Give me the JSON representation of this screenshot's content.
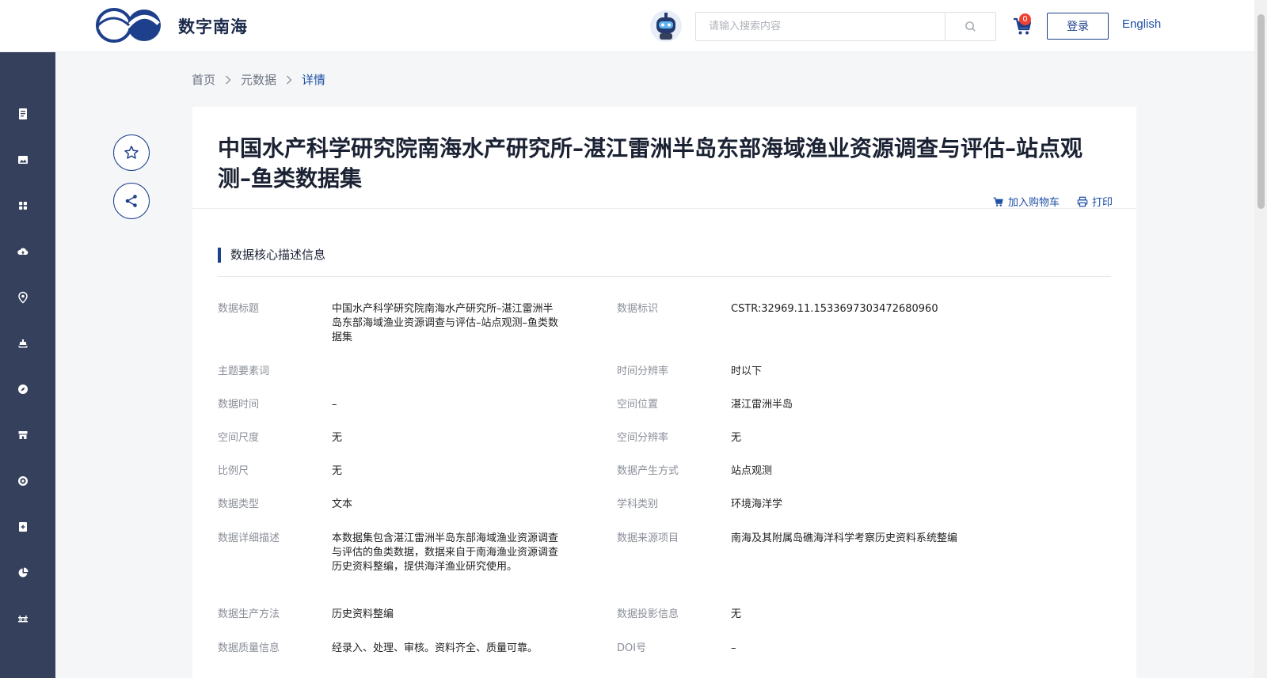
{
  "header": {
    "brand": "数字南海",
    "search_placeholder": "请输入搜索内容",
    "cart_count": "0",
    "login_label": "登录",
    "language_label": "English",
    "accent_color": "#1d3f8c"
  },
  "sidebar": {
    "icons": [
      "document-icon",
      "image-icon",
      "grid-icon",
      "cloud-upload-icon",
      "location-pin-icon",
      "ship-icon",
      "compass-icon",
      "store-icon",
      "target-icon",
      "add-file-icon",
      "pie-chart-icon",
      "bridge-icon"
    ]
  },
  "breadcrumb": {
    "home": "首页",
    "metadata": "元数据",
    "current": "详情"
  },
  "dataset": {
    "title": "中国水产科学研究院南海水产研究所–湛江雷洲半岛东部海域渔业资源调查与评估–站点观测–鱼类数据集",
    "add_to_cart": "加入购物车",
    "print": "打印"
  },
  "section": {
    "title": "数据核心描述信息"
  },
  "fields": {
    "data_title_label": "数据标题",
    "data_title_value": "中国水产科学研究院南海水产研究所–湛江雷洲半岛东部海域渔业资源调查与评估–站点观测–鱼类数据集",
    "data_id_label": "数据标识",
    "data_id_value": "CSTR:32969.11.1533697303472680960",
    "keywords_label": "主题要素词",
    "keywords_value": "",
    "time_res_label": "时间分辨率",
    "time_res_value": "时以下",
    "data_time_label": "数据时间",
    "data_time_value": "–",
    "spatial_loc_label": "空间位置",
    "spatial_loc_value": "湛江雷洲半岛",
    "spatial_scale_label": "空间尺度",
    "spatial_scale_value": "无",
    "spatial_res_label": "空间分辨率",
    "spatial_res_value": "无",
    "scale_label": "比例尺",
    "scale_value": "无",
    "gen_method_label": "数据产生方式",
    "gen_method_value": "站点观测",
    "data_type_label": "数据类型",
    "data_type_value": "文本",
    "discipline_label": "学科类别",
    "discipline_value": "环境海洋学",
    "description_label": "数据详细描述",
    "description_value": "本数据集包含湛江雷洲半岛东部海域渔业资源调查与评估的鱼类数据，数据来自于南海渔业资源调查历史资料整编，提供海洋渔业研究使用。",
    "source_project_label": "数据来源项目",
    "source_project_value": "南海及其附属岛礁海洋科学考察历史资料系统整编",
    "production_label": "数据生产方法",
    "production_value": "历史资料整编",
    "projection_label": "数据投影信息",
    "projection_value": "无",
    "quality_label": "数据质量信息",
    "quality_value": "经录入、处理、审核。资料齐全、质量可靠。",
    "doi_label": "DOI号",
    "doi_value": "–"
  }
}
